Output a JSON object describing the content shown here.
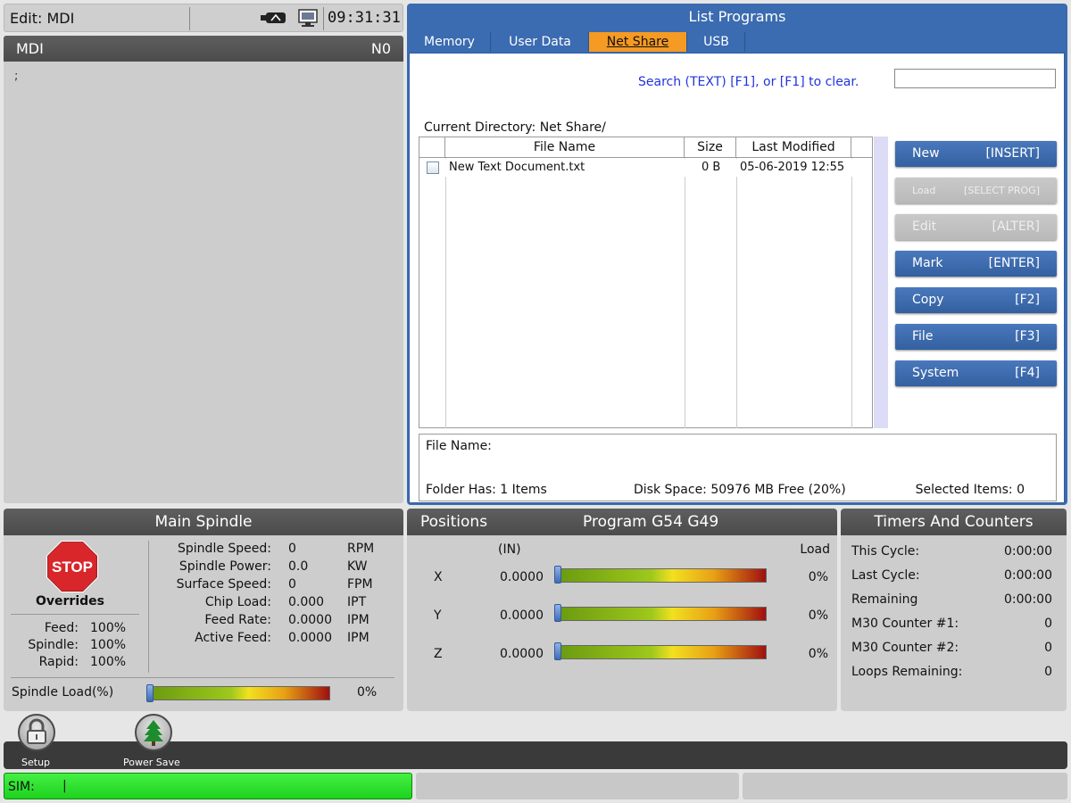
{
  "topbar": {
    "mode": "Edit: MDI",
    "clock": "09:31:31",
    "usb_icon": "usb-drive-icon",
    "network_icon": "network-share-icon"
  },
  "mdi": {
    "title": "MDI",
    "line": "N0",
    "cursor_text": ";"
  },
  "list_programs": {
    "title": "List Programs",
    "tabs": [
      {
        "label": "Memory"
      },
      {
        "label": "User Data"
      },
      {
        "label": "Net Share",
        "active": true
      },
      {
        "label": "USB"
      }
    ],
    "search_label": "Search (TEXT) [F1], or [F1] to clear.",
    "search_value": "",
    "current_directory": "Current Directory: Net Share/",
    "columns": [
      "File Name",
      "Size",
      "Last Modified"
    ],
    "files": [
      {
        "name": "New Text Document.txt",
        "size": "0 B",
        "modified": "05-06-2019 12:55"
      }
    ],
    "buttons": [
      {
        "label": "New",
        "key": "[INSERT]",
        "enabled": true
      },
      {
        "label": "Load",
        "key": "[SELECT PROG]",
        "enabled": false
      },
      {
        "label": "Edit",
        "key": "[ALTER]",
        "enabled": false
      },
      {
        "label": "Mark",
        "key": "[ENTER]",
        "enabled": true
      },
      {
        "label": "Copy",
        "key": "[F2]",
        "enabled": true
      },
      {
        "label": "File",
        "key": "[F3]",
        "enabled": true
      },
      {
        "label": "System",
        "key": "[F4]",
        "enabled": true
      }
    ],
    "file_name_label": "File Name:",
    "folder_has": "Folder Has: 1 Items",
    "disk_space": "Disk Space: 50976 MB Free (20%)",
    "selected_items": "Selected Items: 0"
  },
  "main_spindle": {
    "title": "Main Spindle",
    "stop_label": "STOP",
    "overrides_title": "Overrides",
    "overrides": [
      {
        "label": "Feed:",
        "value": "100%"
      },
      {
        "label": "Spindle:",
        "value": "100%"
      },
      {
        "label": "Rapid:",
        "value": "100%"
      }
    ],
    "readouts": [
      {
        "label": "Spindle Speed:",
        "value": "0",
        "unit": "RPM"
      },
      {
        "label": "Spindle Power:",
        "value": "0.0",
        "unit": "KW"
      },
      {
        "label": "Surface Speed:",
        "value": "0",
        "unit": "FPM"
      },
      {
        "label": "Chip Load:",
        "value": "0.000",
        "unit": "IPT"
      },
      {
        "label": "Feed Rate:",
        "value": "0.0000",
        "unit": "IPM"
      },
      {
        "label": "Active Feed:",
        "value": "0.0000",
        "unit": "IPM"
      }
    ],
    "spindle_load_label": "Spindle Load(%)",
    "spindle_load_value": "0%",
    "spindle_load_fraction": 0
  },
  "positions": {
    "title": "Positions",
    "subtitle": "Program G54 G49",
    "units": "(IN)",
    "load_label": "Load",
    "axes": [
      {
        "axis": "X",
        "value": "0.0000",
        "load": "0%",
        "load_fraction": 0
      },
      {
        "axis": "Y",
        "value": "0.0000",
        "load": "0%",
        "load_fraction": 0
      },
      {
        "axis": "Z",
        "value": "0.0000",
        "load": "0%",
        "load_fraction": 0
      }
    ]
  },
  "timers": {
    "title": "Timers And Counters",
    "rows": [
      {
        "label": "This Cycle:",
        "value": "0:00:00"
      },
      {
        "label": "Last Cycle:",
        "value": "0:00:00"
      },
      {
        "label": "Remaining",
        "value": "0:00:00"
      },
      {
        "label": "M30 Counter #1:",
        "value": "0"
      },
      {
        "label": "M30 Counter #2:",
        "value": "0"
      },
      {
        "label": "Loops Remaining:",
        "value": "0"
      }
    ]
  },
  "dock": {
    "setup_label": "Setup",
    "setup_icon": "padlock-icon",
    "power_save_label": "Power Save",
    "power_save_icon": "tree-icon"
  },
  "status": {
    "sim_label": "SIM:",
    "sim_cursor": "|"
  },
  "colors": {
    "accent_blue": "#3b6bb0",
    "active_tab": "#f59a23",
    "sim_green": "#2ee02e",
    "stop_red": "#d8262b"
  }
}
